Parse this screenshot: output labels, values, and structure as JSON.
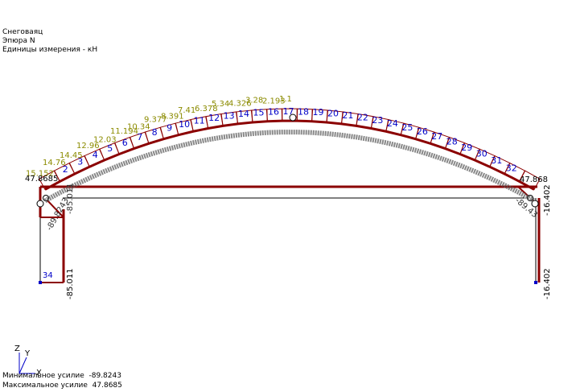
{
  "header": {
    "line1": "Снеговаяц",
    "line2": "Эпюра  N",
    "line3": "Единицы измерения - кН"
  },
  "footer": {
    "min_label": "Минимальное усилие",
    "min_value": "-89.8243",
    "max_label": "Максимальное усилие",
    "max_value": "47.8685"
  },
  "axes": {
    "z": "Z",
    "y": "Y",
    "x": "X"
  },
  "labels": {
    "left_top_value": "47.8685",
    "right_top_value": "47.868",
    "left_column_value": "-85.011",
    "left_column_upper": "-85.011",
    "right_column_value": "-16.402",
    "right_column_upper": "-16.402",
    "left_side_value": "-89.8243",
    "right_side_value": "-89.43",
    "column_number": "34"
  },
  "element_numbers": [
    "2",
    "3",
    "4",
    "5",
    "6",
    "7",
    "8",
    "9",
    "10",
    "11",
    "12",
    "13",
    "14",
    "15",
    "16",
    "17",
    "18",
    "19",
    "20",
    "21",
    "22",
    "23",
    "24",
    "25",
    "26",
    "27",
    "28",
    "29",
    "30",
    "31",
    "32"
  ],
  "upper_values": [
    "15.152",
    "14.76",
    "14.45",
    "12.96",
    "12.03",
    "11.194",
    "10.34",
    "9.377",
    "8.391",
    "7.41",
    "6.378",
    "5.34",
    "4.326",
    "3.28",
    "2.193",
    "1.1"
  ],
  "colors": {
    "diagram": "#8b0000",
    "element_number": "#0000c8",
    "upper_value": "#8b8b00",
    "lower_value": "#333333",
    "structure": "#000000"
  }
}
